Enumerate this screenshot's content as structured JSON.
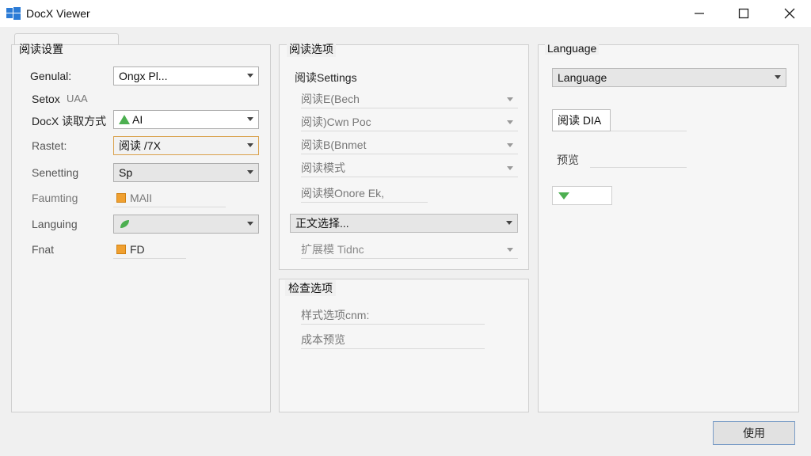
{
  "window": {
    "title": "DocX Viewer"
  },
  "left_panel": {
    "title": "阅读设置",
    "rows": [
      {
        "label": "Genulal:",
        "value": "Ongx Pl..."
      },
      {
        "label": "Setox",
        "value": "UAA"
      },
      {
        "label": "DocX 读取方式",
        "value": "AI"
      },
      {
        "label": "Rastet:",
        "value": "阅读 /7X"
      },
      {
        "label": "Senetting",
        "value": "Sp"
      },
      {
        "label": "Faumting",
        "value": "MAlI"
      },
      {
        "label": "Languing",
        "value": ""
      },
      {
        "label": "Fnat",
        "value": "FD"
      }
    ]
  },
  "middle_panel": {
    "title": "阅读选项",
    "subtitle": "阅读Settings",
    "rows": [
      {
        "value": "阅读E(Bech"
      },
      {
        "value": "阅读)Cwn Poc"
      },
      {
        "value": "阅读B(Bnmet"
      },
      {
        "value": "阅读模式"
      },
      {
        "value": "阅读模Onore Ek,"
      },
      {
        "value": "正文选择..."
      },
      {
        "value": "扩展模 Tidnc"
      }
    ]
  },
  "bottom_middle_panel": {
    "title": "检查选项",
    "rows": [
      {
        "value": "样式选项cnm:"
      },
      {
        "value": "成本预览"
      }
    ]
  },
  "right_panel": {
    "title": "Language",
    "language_value": "Language",
    "field_value": "阅读 DIA",
    "label": "预览"
  },
  "action_button": {
    "label": "使用"
  },
  "colors": {
    "accent_border": "#7a9cc6",
    "orange_border": "#d9a04a",
    "green_icon": "#4caf50",
    "orange_square": "#f0a030"
  }
}
